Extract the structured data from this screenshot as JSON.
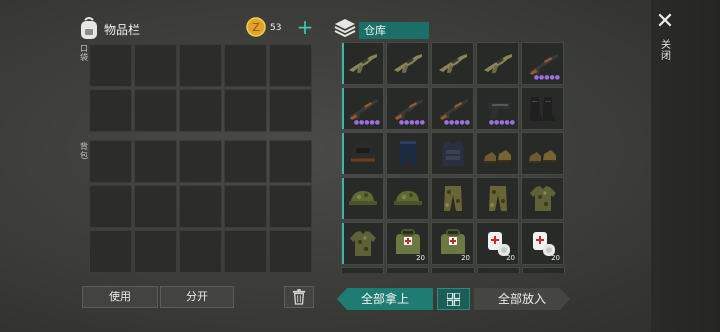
{
  "inventory": {
    "title": "物品栏",
    "coins": "53",
    "add_symbol": "+",
    "pocket_label": "口袋",
    "backpack_label": "背包",
    "use_label": "使用",
    "split_label": "分开"
  },
  "warehouse": {
    "title": "仓库",
    "take_all_label": "全部拿上",
    "put_all_label": "全部放入",
    "slots": [
      {
        "icon": "rifle-icon",
        "dots": ""
      },
      {
        "icon": "rifle-icon",
        "dots": ""
      },
      {
        "icon": "rifle-icon",
        "dots": ""
      },
      {
        "icon": "rifle-icon",
        "dots": ""
      },
      {
        "icon": "assault-rifle-icon",
        "dots": "●●●●●"
      },
      {
        "icon": "assault-rifle-icon",
        "dots": "●●●●●"
      },
      {
        "icon": "assault-rifle-icon",
        "dots": "●●●●●"
      },
      {
        "icon": "assault-rifle-icon",
        "dots": "●●●●●"
      },
      {
        "icon": "pistol-icon",
        "dots": "●●●●●"
      },
      {
        "icon": "boots-icon",
        "dots": ""
      },
      {
        "icon": "helmet-icon",
        "dots": ""
      },
      {
        "icon": "pants-icon",
        "dots": ""
      },
      {
        "icon": "vest-icon",
        "dots": ""
      },
      {
        "icon": "shoes-icon",
        "dots": ""
      },
      {
        "icon": "shoes-icon",
        "dots": ""
      },
      {
        "icon": "cap-icon",
        "dots": ""
      },
      {
        "icon": "cap-icon",
        "dots": ""
      },
      {
        "icon": "camo-pants-icon",
        "dots": ""
      },
      {
        "icon": "camo-pants-icon",
        "dots": ""
      },
      {
        "icon": "camo-jacket-icon",
        "dots": ""
      },
      {
        "icon": "camo-jacket-icon",
        "qty": ""
      },
      {
        "icon": "medkit-bag-icon",
        "qty": "20"
      },
      {
        "icon": "medkit-bag-icon",
        "qty": "20"
      },
      {
        "icon": "bandage-icon",
        "qty": "20"
      },
      {
        "icon": "bandage-icon",
        "qty": "20"
      }
    ]
  },
  "side": {
    "close_symbol": "✕",
    "close_label": "关闭"
  },
  "colors": {
    "accent": "#1f7c72",
    "rarity_dots": "#9b6fe0",
    "coin": "#e0a526"
  }
}
